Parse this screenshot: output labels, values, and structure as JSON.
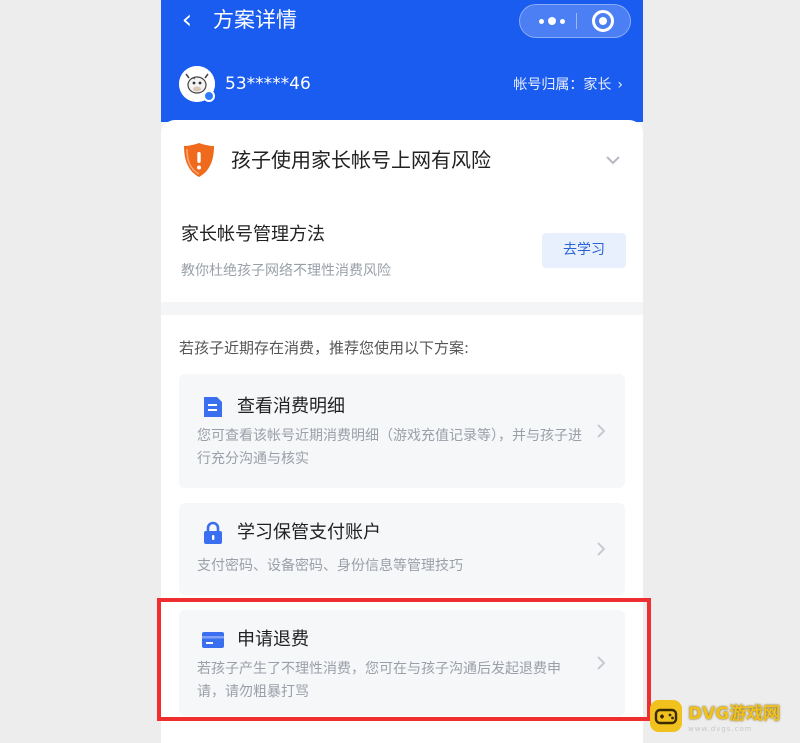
{
  "header": {
    "title": "方案详情",
    "account_id": "53*****46",
    "ownership_label": "帐号归属：家长",
    "ownership_chevron": "›"
  },
  "risk_card": {
    "title": "孩子使用家长帐号上网有风险",
    "manage_title": "家长帐号管理方法",
    "manage_sub": "教你杜绝孩子网络不理性消费风险",
    "learn_button": "去学习"
  },
  "plans": {
    "intro": "若孩子近期存在消费，推荐您使用以下方案:",
    "items": [
      {
        "icon": "document-icon",
        "title": "查看消费明细",
        "desc": "您可查看该帐号近期消费明细（游戏充值记录等），并与孩子进行充分沟通与核实"
      },
      {
        "icon": "lock-icon",
        "title": "学习保管支付账户",
        "desc": "支付密码、设备密码、身份信息等管理技巧"
      },
      {
        "icon": "card-icon",
        "title": "申请退费",
        "desc": "若孩子产生了不理性消费，您可在与孩子沟通后发起退费申请，请勿粗暴打骂"
      }
    ]
  },
  "watermark": {
    "text": "DVG游戏网",
    "sub": "www.dvgs.com"
  },
  "colors": {
    "header_blue": "#1a5cf0",
    "highlight_red": "#ef2f2f",
    "risk_orange": "#f06a1d",
    "icon_blue": "#3a6ff0"
  }
}
